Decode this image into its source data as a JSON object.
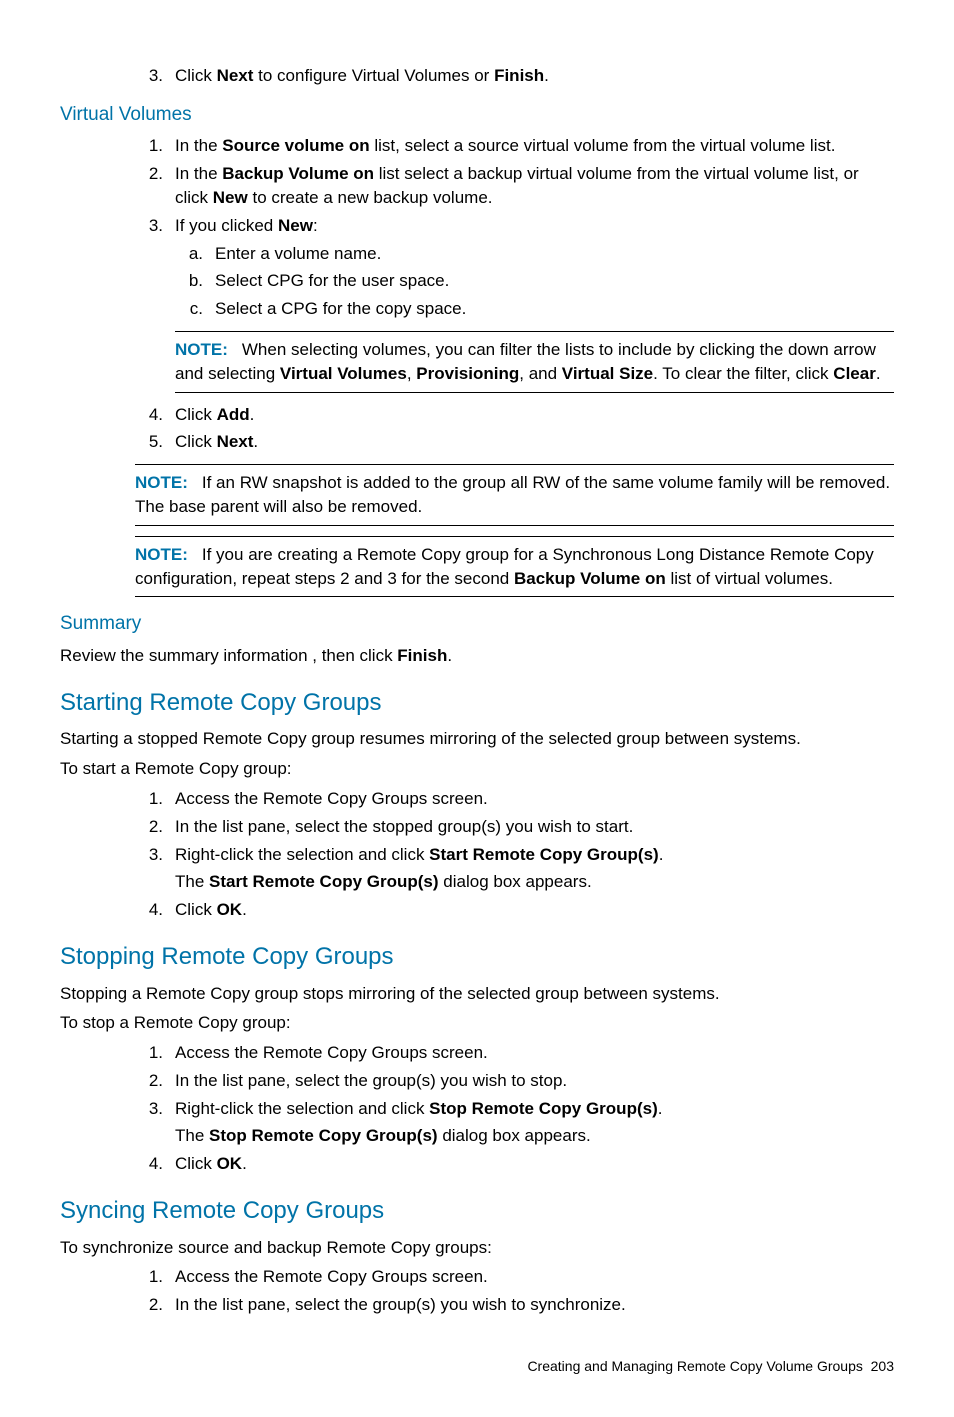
{
  "top_step3_pre": "Click ",
  "top_step3_b1": "Next",
  "top_step3_mid": " to configure Virtual Volumes or ",
  "top_step3_b2": "Finish",
  "top_step3_end": ".",
  "vv_heading": "Virtual Volumes",
  "vv1_pre": "In the ",
  "vv1_b": "Source volume on",
  "vv1_post": " list, select a source virtual volume from the virtual volume list.",
  "vv2_pre": "In the ",
  "vv2_b1": "Backup Volume on",
  "vv2_mid": " list select a backup virtual volume from the virtual volume list, or click ",
  "vv2_b2": "New",
  "vv2_post": " to create a new backup volume.",
  "vv3_pre": "If you clicked ",
  "vv3_b": "New",
  "vv3_post": ":",
  "vv3a": "Enter a volume name.",
  "vv3b": "Select CPG for the user space.",
  "vv3c": "Select a CPG for the copy space.",
  "note1_label": "NOTE:",
  "note1_pre": "When selecting volumes, you can filter the lists to include by clicking the down arrow and selecting ",
  "note1_b1": "Virtual Volumes",
  "note1_s1": ", ",
  "note1_b2": "Provisioning",
  "note1_s2": ", and ",
  "note1_b3": "Virtual Size",
  "note1_s3": ". To clear the filter, click ",
  "note1_b4": "Clear",
  "note1_end": ".",
  "vv4_pre": "Click ",
  "vv4_b": "Add",
  "vv4_end": ".",
  "vv5_pre": "Click ",
  "vv5_b": "Next",
  "vv5_end": ".",
  "note2_label": "NOTE:",
  "note2_text": "If an RW snapshot is added to the group all RW of the same volume family will be removed. The base parent will also be removed.",
  "note3_label": "NOTE:",
  "note3_pre": "If you are creating a Remote Copy group for a Synchronous Long Distance Remote Copy configuration, repeat steps 2 and 3 for the second ",
  "note3_b": "Backup Volume on",
  "note3_post": " list of virtual volumes.",
  "summary_heading": "Summary",
  "summary_pre": "Review the summary information , then click ",
  "summary_b": "Finish",
  "summary_end": ".",
  "start_heading": "Starting Remote Copy Groups",
  "start_intro": "Starting a stopped Remote Copy group resumes mirroring of the selected group between systems.",
  "start_lead": "To start a Remote Copy group:",
  "start1": "Access the Remote Copy Groups screen.",
  "start2": "In the list pane, select the stopped group(s) you wish to start.",
  "start3_pre": "Right-click the selection and click ",
  "start3_b": "Start Remote Copy Group(s)",
  "start3_end": ".",
  "start3_line2_pre": "The ",
  "start3_line2_b": "Start Remote Copy Group(s)",
  "start3_line2_post": " dialog box appears.",
  "start4_pre": "Click ",
  "start4_b": "OK",
  "start4_end": ".",
  "stop_heading": "Stopping Remote Copy Groups",
  "stop_intro": "Stopping a Remote Copy group stops mirroring of the selected group between systems.",
  "stop_lead": "To stop a Remote Copy group:",
  "stop1": "Access the Remote Copy Groups screen.",
  "stop2": "In the list pane, select the group(s) you wish to stop.",
  "stop3_pre": "Right-click the selection and click ",
  "stop3_b": "Stop Remote Copy Group(s)",
  "stop3_end": ".",
  "stop3_line2_pre": "The ",
  "stop3_line2_b": "Stop Remote Copy Group(s)",
  "stop3_line2_post": " dialog box appears.",
  "stop4_pre": "Click ",
  "stop4_b": "OK",
  "stop4_end": ".",
  "sync_heading": "Syncing Remote Copy Groups",
  "sync_lead": "To synchronize source and backup Remote Copy groups:",
  "sync1": "Access the Remote Copy Groups screen.",
  "sync2": "In the list pane, select the group(s) you wish to synchronize.",
  "footer_text": "Creating and Managing Remote Copy Volume Groups",
  "footer_page": "203"
}
